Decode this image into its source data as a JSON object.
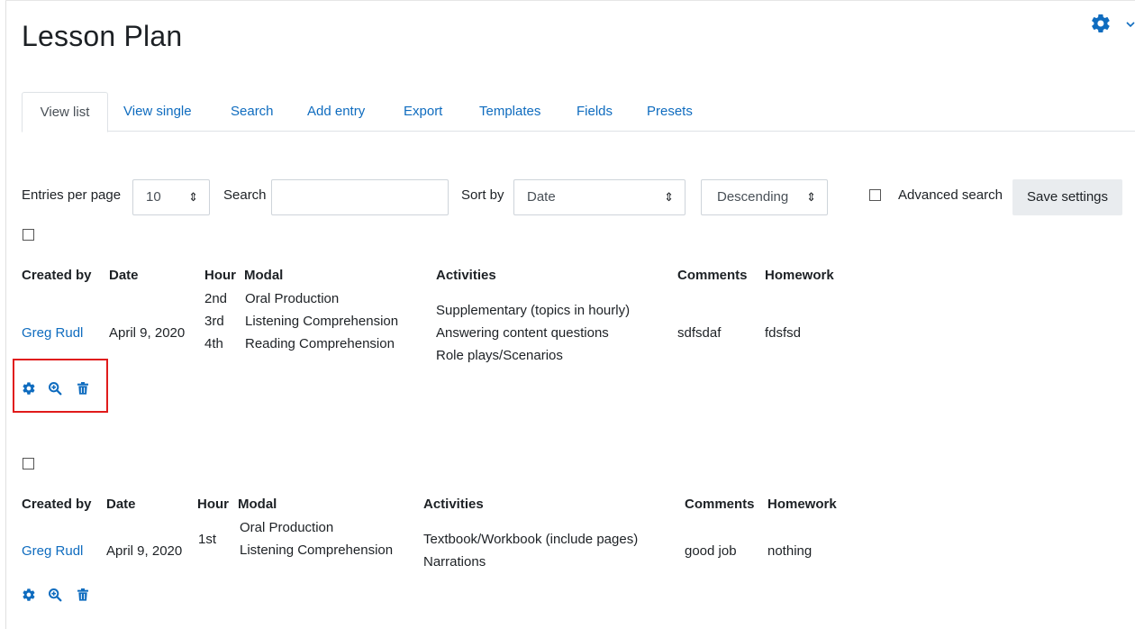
{
  "page": {
    "title": "Lesson Plan"
  },
  "tabs": [
    "View list",
    "View single",
    "Search",
    "Add entry",
    "Export",
    "Templates",
    "Fields",
    "Presets"
  ],
  "controls": {
    "entries_label": "Entries per page",
    "entries_value": "10",
    "search_label": "Search",
    "search_value": "",
    "sort_label": "Sort by",
    "sort_value": "Date",
    "order_value": "Descending",
    "advanced_label": "Advanced search",
    "save_label": "Save settings",
    "select_arrows": "⇕"
  },
  "headers": {
    "created_by": "Created by",
    "date": "Date",
    "hour": "Hour",
    "modal": "Modal",
    "activities": "Activities",
    "comments": "Comments",
    "homework": "Homework"
  },
  "entries": [
    {
      "author": "Greg Rudl",
      "date": "April 9, 2020",
      "hours": [
        "2nd",
        "3rd",
        "4th"
      ],
      "modals": [
        "Oral Production",
        "Listening Comprehension",
        "Reading Comprehension"
      ],
      "activities": [
        "Supplementary (topics in hourly)",
        "Answering content questions",
        "Role plays/Scenarios"
      ],
      "comments": "sdfsdaf",
      "homework": "fdsfsd"
    },
    {
      "author": "Greg Rudl",
      "date": "April 9, 2020",
      "hours": [
        "1st"
      ],
      "modals": [
        "Oral Production",
        "Listening Comprehension"
      ],
      "activities": [
        "Textbook/Workbook (include pages)",
        "Narrations"
      ],
      "comments": "good job",
      "homework": "nothing"
    }
  ],
  "icons": {
    "edit": "gear-icon",
    "view": "zoom-in-icon",
    "delete": "trash-icon"
  },
  "colors": {
    "link": "#0f6cbf",
    "highlight": "#e01b1b"
  }
}
